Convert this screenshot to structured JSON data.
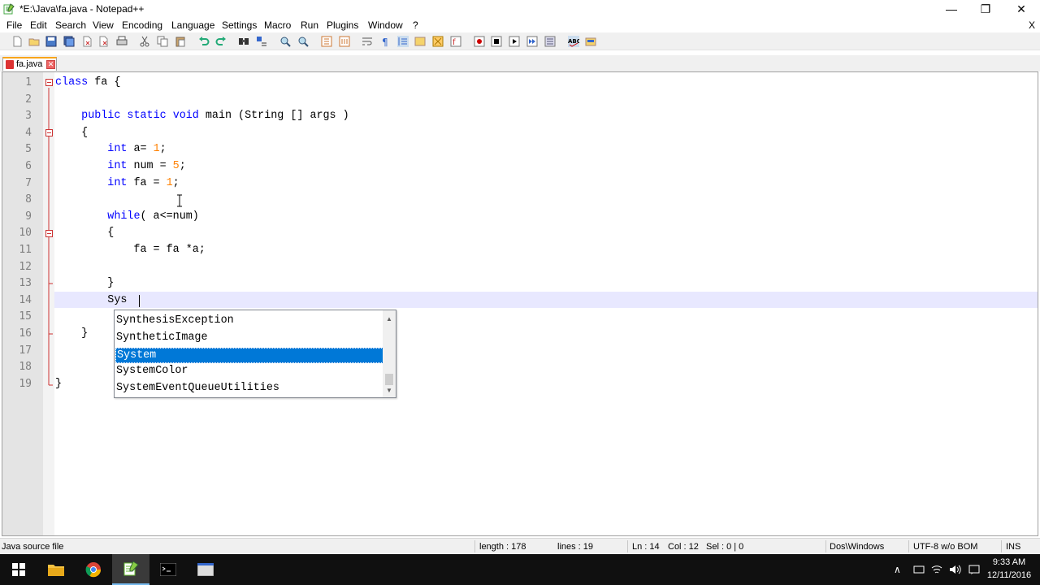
{
  "window": {
    "title": "*E:\\Java\\fa.java - Notepad++",
    "menu_close": "X"
  },
  "menu": [
    "File",
    "Edit",
    "Search",
    "View",
    "Encoding",
    "Language",
    "Settings",
    "Macro",
    "Run",
    "Plugins",
    "Window",
    "?"
  ],
  "tab": {
    "label": "fa.java",
    "close": "✕"
  },
  "editor": {
    "lines": [
      {
        "n": "1",
        "code": "class fa {"
      },
      {
        "n": "2",
        "code": ""
      },
      {
        "n": "3",
        "code": "    public static void main (String [] args )"
      },
      {
        "n": "4",
        "code": "    {"
      },
      {
        "n": "5",
        "code": "        int a= 1;"
      },
      {
        "n": "6",
        "code": "        int num = 5;"
      },
      {
        "n": "7",
        "code": "        int fa = 1;"
      },
      {
        "n": "8",
        "code": ""
      },
      {
        "n": "9",
        "code": "        while( a<=num)"
      },
      {
        "n": "10",
        "code": "        {"
      },
      {
        "n": "11",
        "code": "            fa = fa *a;"
      },
      {
        "n": "12",
        "code": ""
      },
      {
        "n": "13",
        "code": "        }"
      },
      {
        "n": "14",
        "code": "        Sys"
      },
      {
        "n": "15",
        "code": ""
      },
      {
        "n": "16",
        "code": "    }"
      },
      {
        "n": "17",
        "code": ""
      },
      {
        "n": "18",
        "code": ""
      },
      {
        "n": "19",
        "code": "}"
      }
    ]
  },
  "autocomplete": {
    "items": [
      "SynthesisException",
      "SyntheticImage",
      "System",
      "SystemColor",
      "SystemEventQueueUtilities"
    ],
    "selected": "System"
  },
  "status": {
    "file_type": "Java source file",
    "length": "length : 178",
    "lines": "lines : 19",
    "ln": "Ln : 14",
    "col": "Col : 12",
    "sel": "Sel : 0 | 0",
    "eol": "Dos\\Windows",
    "encoding": "UTF-8 w/o BOM",
    "mode": "INS"
  },
  "taskbar": {
    "time": "9:33 AM",
    "date": "12/11/2016"
  },
  "colors": {
    "keyword": "#0000ff",
    "number": "#ff8000",
    "selection": "#0078d7",
    "current_line": "#e8e8ff"
  }
}
